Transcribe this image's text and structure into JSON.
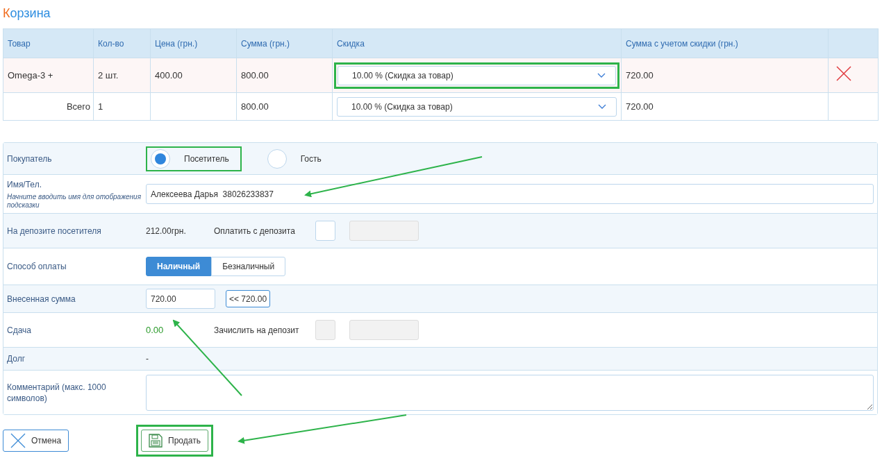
{
  "title": {
    "initial": "К",
    "rest": "орзина"
  },
  "table": {
    "columns": [
      "Товар",
      "Кол-во",
      "Цена (грн.)",
      "Сумма (грн.)",
      "Скидка",
      "Сумма с учетом скидки (грн.)"
    ],
    "rows": [
      {
        "kind": "item",
        "cells": [
          "Omega-3 +",
          "2 шт.",
          "400.00",
          "800.00"
        ],
        "discount": "10.00 % (Скидка за товар)",
        "highlighted": true,
        "total": "720.00",
        "removable": true
      },
      {
        "kind": "total",
        "cells": [
          "Всего",
          "1",
          "",
          "800.00"
        ],
        "discount": "10.00 % (Скидка за товар)",
        "highlighted": false,
        "total": "720.00",
        "removable": false
      }
    ]
  },
  "form": [
    {
      "kind": "radio",
      "label": "Покупатель",
      "options": [
        {
          "label": "Посетитель",
          "selected": true,
          "highlighted": true
        },
        {
          "label": "Гость",
          "selected": false,
          "highlighted": false
        }
      ]
    },
    {
      "kind": "text",
      "label": "Имя/Тел.",
      "hint": "Начните вводить имя для отображения подсказки",
      "value": "Алексеева Дарья  38026233837"
    },
    {
      "kind": "deposit",
      "label": "На депозите посетителя",
      "amount": "212.00грн.",
      "action_label": "Оплатить с депозита",
      "checked": false,
      "checkbox_disabled": false
    },
    {
      "kind": "segmented",
      "label": "Способ оплаты",
      "options": [
        {
          "label": "Наличный",
          "selected": true
        },
        {
          "label": "Безналичный",
          "selected": false
        }
      ]
    },
    {
      "kind": "amount",
      "label": "Внесенная сумма",
      "value": "720.00",
      "button_label": "<< 720.00"
    },
    {
      "kind": "change",
      "label": "Сдача",
      "amount": "0.00",
      "action_label": "Зачислить на депозит",
      "checked": false,
      "checkbox_disabled": true
    },
    {
      "kind": "value",
      "label": "Долг",
      "value": "-"
    },
    {
      "kind": "textarea",
      "label": "Комментарий (макс. 1000 символов)"
    }
  ],
  "buttons": [
    {
      "kind": "cancel",
      "label": "Отмена",
      "highlighted": false
    },
    {
      "kind": "save",
      "label": "Продать",
      "highlighted": true
    }
  ]
}
